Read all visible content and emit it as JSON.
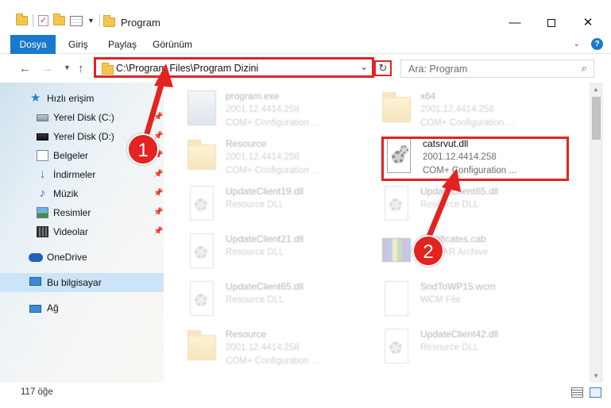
{
  "window": {
    "title": "Program",
    "controls": {
      "minimize": "—",
      "close": "✕"
    }
  },
  "ribbon": {
    "tabs": [
      "Dosya",
      "Giriş",
      "Paylaş",
      "Görünüm"
    ]
  },
  "nav": {
    "address_path": "C:\\Program Files\\Program Dizini",
    "search_placeholder": "Ara: Program"
  },
  "sidebar": {
    "items": [
      {
        "label": "Hızlı erişim",
        "icon": "star-icon"
      },
      {
        "label": "Yerel Disk (C:)",
        "icon": "drive-icon",
        "pinned": true
      },
      {
        "label": "Yerel Disk (D:)",
        "icon": "drive-icon",
        "pinned": true
      },
      {
        "label": "Belgeler",
        "icon": "documents-icon",
        "pinned": true
      },
      {
        "label": "İndirmeler",
        "icon": "download-icon",
        "pinned": true
      },
      {
        "label": "Müzik",
        "icon": "music-icon",
        "pinned": true
      },
      {
        "label": "Resimler",
        "icon": "pictures-icon",
        "pinned": true
      },
      {
        "label": "Videolar",
        "icon": "videos-icon",
        "pinned": true
      },
      {
        "label": "OneDrive",
        "icon": "cloud-icon"
      },
      {
        "label": "Bu bilgisayar",
        "icon": "computer-icon",
        "selected": true
      },
      {
        "label": "Ağ",
        "icon": "network-icon"
      }
    ]
  },
  "files": [
    {
      "name": "program.exe",
      "line1": "2001.12.4414.258",
      "line2": "COM+ Configuration ...",
      "icon": "exe-icon",
      "dimmed": true
    },
    {
      "name": "x64",
      "line1": "2001.12.4414.258",
      "line2": "COM+ Configuration ...",
      "icon": "folder-icon",
      "dimmed": true
    },
    {
      "name": "Resource",
      "line1": "2001.12.4414.258",
      "line2": "COM+ Configuration ...",
      "icon": "folder-icon",
      "dimmed": true
    },
    {
      "name": "catsrvut.dll",
      "line1": "2001.12.4414.258",
      "line2": "COM+ Configuration ...",
      "icon": "dll-icon",
      "dimmed": false
    },
    {
      "name": "UpdateClient19.dll",
      "line1": "Resource DLL",
      "line2": "",
      "icon": "dll-icon",
      "dimmed": true
    },
    {
      "name": "UpdateClient65.dll",
      "line1": "Resource DLL",
      "line2": "",
      "icon": "dll-icon",
      "dimmed": true
    },
    {
      "name": "UpdateClient21.dll",
      "line1": "Resource DLL",
      "line2": "",
      "icon": "dll-icon",
      "dimmed": true
    },
    {
      "name": "Certificates.cab",
      "line1": "WinRAR Archive",
      "line2": "",
      "icon": "archive-icon",
      "dimmed": true
    },
    {
      "name": "UpdateClient65.dll",
      "line1": "Resource DLL",
      "line2": "",
      "icon": "dll-icon",
      "dimmed": true
    },
    {
      "name": "SndToWP15.wcm",
      "line1": "WCM File",
      "line2": "",
      "icon": "file-icon",
      "dimmed": true
    },
    {
      "name": "Resource",
      "line1": "2001.12.4414.258",
      "line2": "COM+ Configuration ...",
      "icon": "folder-icon",
      "dimmed": true
    },
    {
      "name": "UpdateClient42.dll",
      "line1": "Resource DLL",
      "line2": "",
      "icon": "dll-icon",
      "dimmed": true
    }
  ],
  "status": {
    "item_count": "117 öğe"
  },
  "annotations": {
    "step1": "1",
    "step2": "2",
    "color": "#e2231f"
  }
}
